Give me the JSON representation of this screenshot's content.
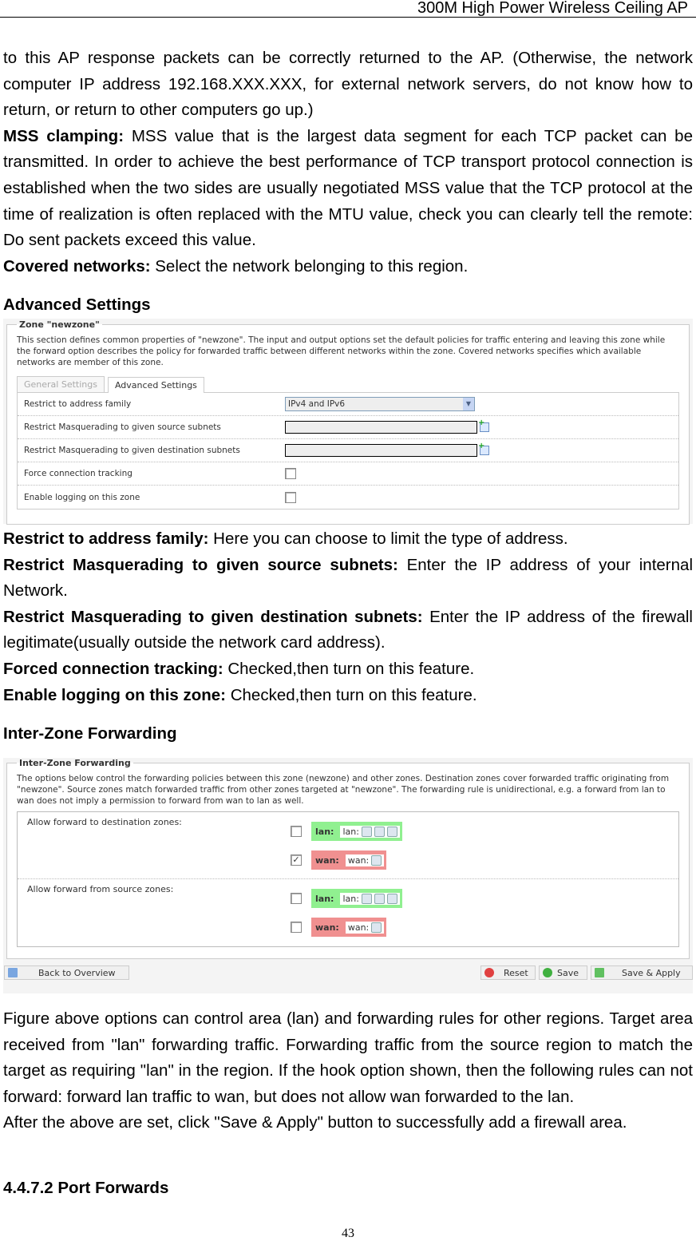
{
  "header": {
    "title": "300M High Power Wireless Ceiling AP"
  },
  "intro": {
    "p1": "to this AP response packets can be correctly returned to the AP. (Otherwise, the network computer IP address 192.168.XXX.XXX, for external network servers, do not know how to return, or return to other computers go up.)",
    "mss_term": "MSS clamping:",
    "mss_text": " MSS value that is the largest data segment for each TCP packet can be transmitted. In order to achieve the best performance of TCP transport protocol connection is established when the two sides are usually negotiated MSS value that the TCP protocol at the time of realization is often replaced with the MTU value, check you can clearly tell the remote: Do sent packets exceed this value.",
    "cov_term": "Covered networks:",
    "cov_text": " Select the network belonging to this region."
  },
  "adv_heading": "Advanced Settings",
  "zone_shot": {
    "legend": "Zone \"newzone\"",
    "desc": "This section defines common properties of \"newzone\". The input and output options set the default policies for traffic entering and leaving this zone while the forward option describes the policy for forwarded traffic between different networks within the zone. Covered networks specifies which available networks are member of this zone.",
    "tabs": [
      "General Settings",
      "Advanced Settings"
    ],
    "rows": [
      {
        "label": "Restrict to address family",
        "value": "IPv4 and IPv6"
      },
      {
        "label": "Restrict Masquerading to given source subnets"
      },
      {
        "label": "Restrict Masquerading to given destination subnets"
      },
      {
        "label": "Force connection tracking",
        "checked": false
      },
      {
        "label": "Enable logging on this zone",
        "checked": false
      }
    ]
  },
  "adv_desc": [
    {
      "term": "Restrict to address family:",
      "text": " Here you can choose to limit the type of address."
    },
    {
      "term": "Restrict Masquerading to given source subnets:",
      "text": " Enter the IP address of your internal Network."
    },
    {
      "term": "Restrict Masquerading to given destination subnets:",
      "text": " Enter the IP address of the firewall legitimate(usually outside the network card address)."
    },
    {
      "term": "Forced connection tracking:",
      "text": " Checked,then turn on this feature."
    },
    {
      "term": "Enable logging on this zone:",
      "text": " Checked,then turn on this feature."
    }
  ],
  "izf_heading": "Inter-Zone Forwarding",
  "izf_shot": {
    "legend": "Inter-Zone Forwarding",
    "desc": "The options below control the forwarding policies between this zone (newzone) and other zones. Destination zones cover forwarded traffic originating from \"newzone\". Source zones match forwarded traffic from other zones targeted at \"newzone\". The forwarding rule is unidirectional, e.g. a forward from lan to wan does not imply a permission to forward from wan to lan as well.",
    "dest_label": "Allow forward to destination zones:",
    "src_label": "Allow forward from source zones:",
    "dest": [
      {
        "zone": "lan:",
        "net": "lan:",
        "checked": false
      },
      {
        "zone": "wan:",
        "net": "wan:",
        "checked": true
      }
    ],
    "src": [
      {
        "zone": "lan:",
        "net": "lan:",
        "checked": false
      },
      {
        "zone": "wan:",
        "net": "wan:",
        "checked": false
      }
    ],
    "buttons": {
      "back": "Back to Overview",
      "reset": "Reset",
      "save": "Save",
      "apply": "Save & Apply"
    },
    "colors": {
      "lan": "#90f090",
      "wan": "#f09090"
    }
  },
  "outro": {
    "p1": "Figure above options can control area (lan) and forwarding rules for other regions. Target area received from \"lan\" forwarding traffic. Forwarding traffic from the source region to match the target as requiring \"lan\" in the region. If the hook option shown, then the following rules can not forward: forward lan traffic to wan, but does not allow wan forwarded to the lan.",
    "p2": "After the above are set, click \"Save & Apply\" button to successfully add a firewall area."
  },
  "section_heading": "4.4.7.2 Port Forwards",
  "page_number": "43"
}
